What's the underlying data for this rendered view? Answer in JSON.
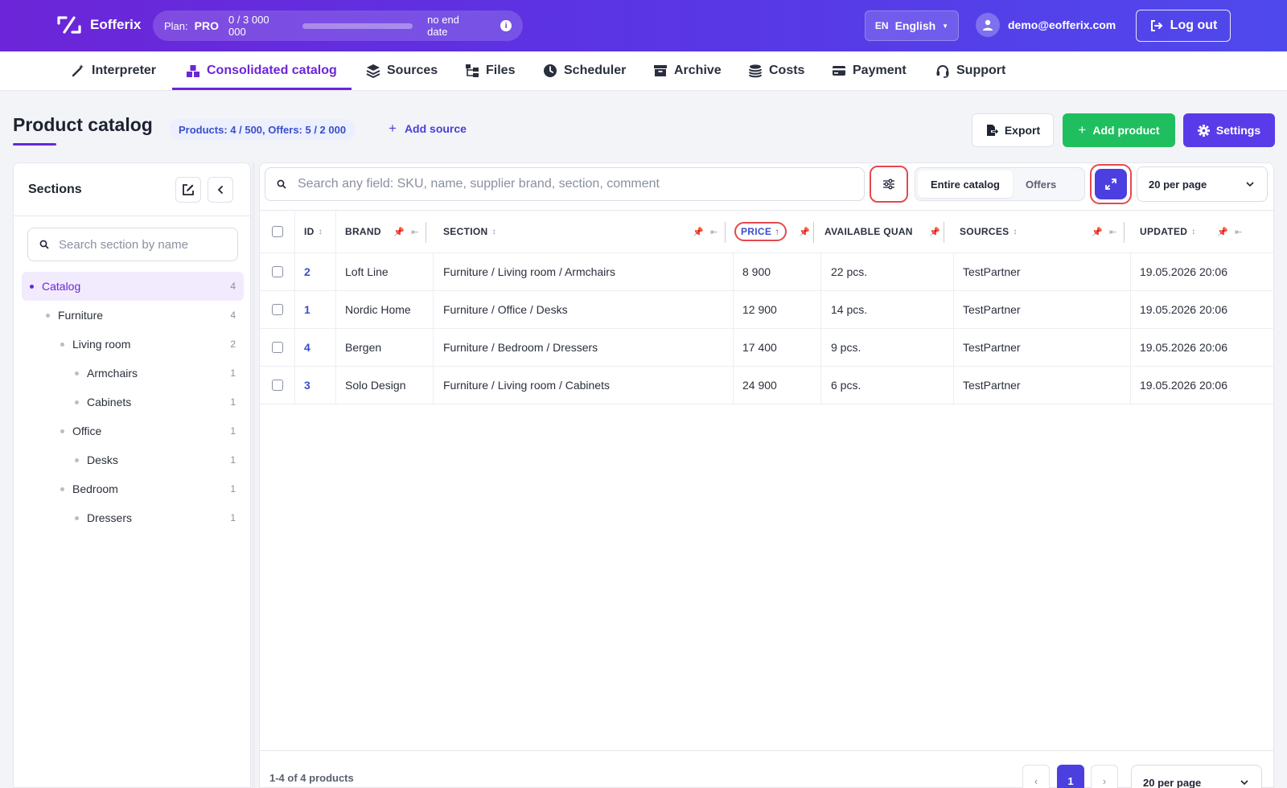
{
  "header": {
    "brand": "Eofferix",
    "plan_label": "Plan:",
    "plan_name": "PRO",
    "plan_usage": "0 / 3 000 000",
    "plan_progress": 0,
    "plan_expiry": "no end date",
    "lang_code": "EN",
    "lang_name": "English",
    "user_email": "demo@eofferix.com",
    "logout_label": "Log out"
  },
  "nav": {
    "items": [
      {
        "label": "Interpreter"
      },
      {
        "label": "Consolidated catalog"
      },
      {
        "label": "Sources"
      },
      {
        "label": "Files"
      },
      {
        "label": "Scheduler"
      },
      {
        "label": "Archive"
      },
      {
        "label": "Costs"
      },
      {
        "label": "Payment"
      },
      {
        "label": "Support"
      }
    ],
    "active": "Consolidated catalog"
  },
  "page": {
    "title": "Product catalog",
    "stats": "Products: 4 / 500, Offers: 5 / 2 000",
    "add_source": "Add source",
    "export_label": "Export",
    "add_product_label": "Add product",
    "settings_label": "Settings"
  },
  "sidebar": {
    "title": "Sections",
    "search_placeholder": "Search section by name",
    "tree": [
      {
        "label": "Catalog",
        "count": "4"
      },
      {
        "label": "Furniture",
        "count": "4"
      },
      {
        "label": "Living room",
        "count": "2"
      },
      {
        "label": "Armchairs",
        "count": "1"
      },
      {
        "label": "Cabinets",
        "count": "1"
      },
      {
        "label": "Office",
        "count": "1"
      },
      {
        "label": "Desks",
        "count": "1"
      },
      {
        "label": "Bedroom",
        "count": "1"
      },
      {
        "label": "Dressers",
        "count": "1"
      }
    ]
  },
  "toolbar": {
    "search_placeholder": "Search any field: SKU, name, supplier brand, section, comment",
    "scope_entire": "Entire catalog",
    "scope_offers": "Offers",
    "per_page": "20 per page"
  },
  "table": {
    "columns": {
      "id": "ID",
      "brand": "BRAND",
      "section": "SECTION",
      "price": "PRICE",
      "quantity": "AVAILABLE QUAN",
      "sources": "SOURCES",
      "updated": "UPDATED"
    },
    "rows": [
      {
        "id": "2",
        "brand": "Loft Line",
        "section": "Furniture / Living room / Armchairs",
        "price": "8 900",
        "quantity": "22 pcs.",
        "sources": "TestPartner",
        "updated": "19.05.2026 20:06"
      },
      {
        "id": "1",
        "brand": "Nordic Home",
        "section": "Furniture / Office / Desks",
        "price": "12 900",
        "quantity": "14 pcs.",
        "sources": "TestPartner",
        "updated": "19.05.2026 20:06"
      },
      {
        "id": "4",
        "brand": "Bergen",
        "section": "Furniture / Bedroom / Dressers",
        "price": "17 400",
        "quantity": "9 pcs.",
        "sources": "TestPartner",
        "updated": "19.05.2026 20:06"
      },
      {
        "id": "3",
        "brand": "Solo Design",
        "section": "Furniture / Living room / Cabinets",
        "price": "24 900",
        "quantity": "6 pcs.",
        "sources": "TestPartner",
        "updated": "19.05.2026 20:06"
      }
    ]
  },
  "footer": {
    "summary": "1-4 of 4 products",
    "prev": "‹",
    "page": "1",
    "next": "›",
    "per_page": "20 per page"
  }
}
